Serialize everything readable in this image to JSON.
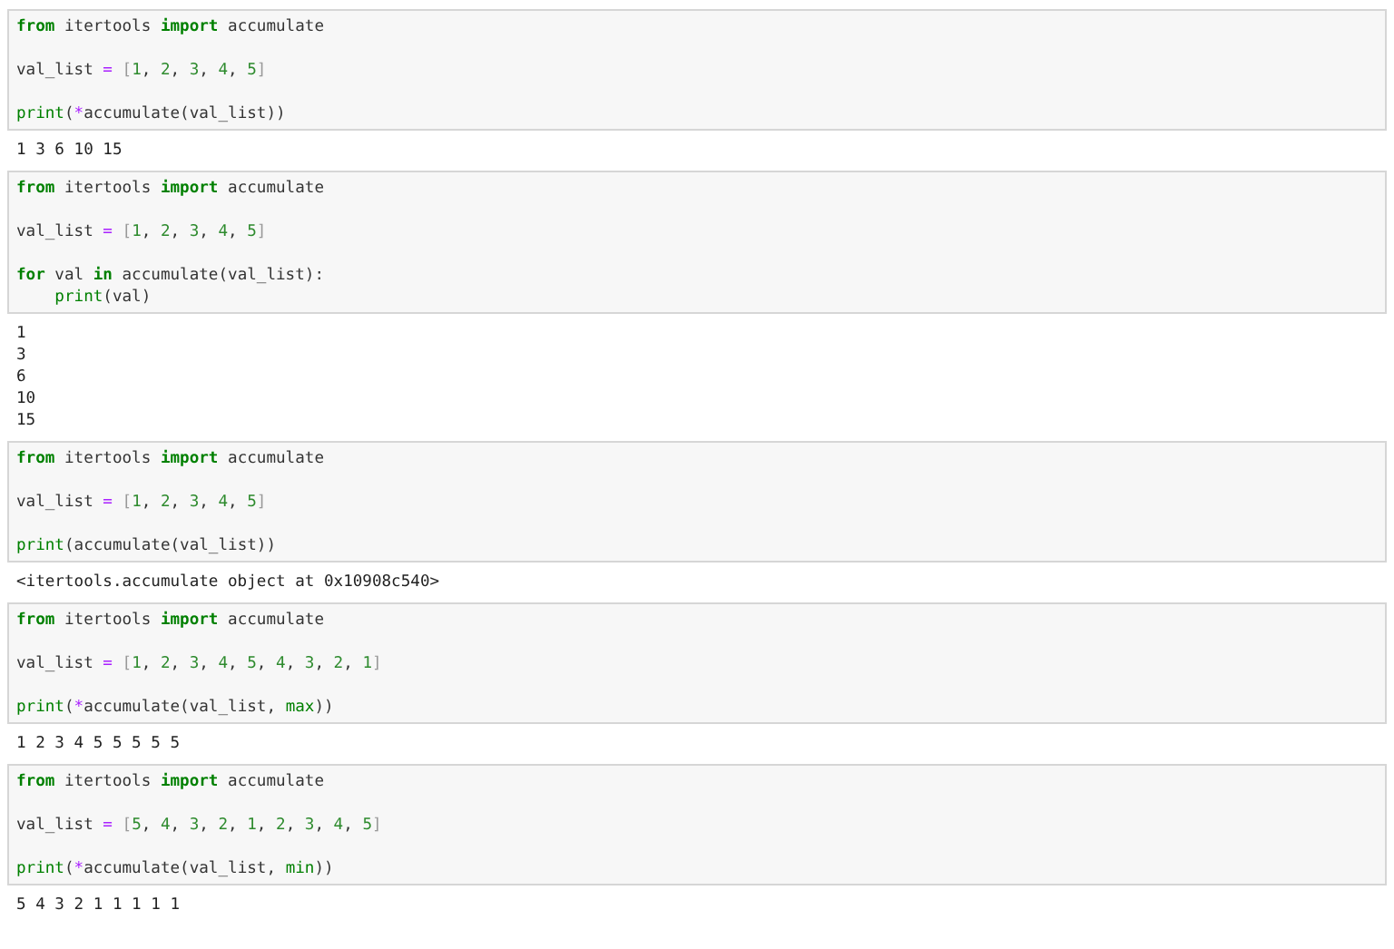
{
  "cells": [
    {
      "code": [
        [
          [
            {
              "text": "from",
              "kind": "kw"
            },
            {
              "text": " itertools ",
              "kind": "txt"
            },
            {
              "text": "import",
              "kind": "kw"
            },
            {
              "text": " accumulate",
              "kind": "txt"
            }
          ]
        ],
        [
          [
            {
              "text": "val_list ",
              "kind": "txt"
            },
            {
              "text": "=",
              "kind": "op"
            },
            {
              "text": " [",
              "kind": "br"
            },
            {
              "text": "1",
              "kind": "num"
            },
            {
              "text": ", ",
              "kind": "txt"
            },
            {
              "text": "2",
              "kind": "num"
            },
            {
              "text": ", ",
              "kind": "txt"
            },
            {
              "text": "3",
              "kind": "num"
            },
            {
              "text": ", ",
              "kind": "txt"
            },
            {
              "text": "4",
              "kind": "num"
            },
            {
              "text": ", ",
              "kind": "txt"
            },
            {
              "text": "5",
              "kind": "num"
            },
            {
              "text": "]",
              "kind": "br"
            }
          ]
        ],
        [
          [
            {
              "text": "print",
              "kind": "bi"
            },
            {
              "text": "(",
              "kind": "txt"
            },
            {
              "text": "*",
              "kind": "op"
            },
            {
              "text": "accumulate(val_list))",
              "kind": "txt"
            }
          ]
        ]
      ],
      "output": [
        "1 3 6 10 15"
      ]
    },
    {
      "code": [
        [
          [
            {
              "text": "from",
              "kind": "kw"
            },
            {
              "text": " itertools ",
              "kind": "txt"
            },
            {
              "text": "import",
              "kind": "kw"
            },
            {
              "text": " accumulate",
              "kind": "txt"
            }
          ]
        ],
        [
          [
            {
              "text": "val_list ",
              "kind": "txt"
            },
            {
              "text": "=",
              "kind": "op"
            },
            {
              "text": " [",
              "kind": "br"
            },
            {
              "text": "1",
              "kind": "num"
            },
            {
              "text": ", ",
              "kind": "txt"
            },
            {
              "text": "2",
              "kind": "num"
            },
            {
              "text": ", ",
              "kind": "txt"
            },
            {
              "text": "3",
              "kind": "num"
            },
            {
              "text": ", ",
              "kind": "txt"
            },
            {
              "text": "4",
              "kind": "num"
            },
            {
              "text": ", ",
              "kind": "txt"
            },
            {
              "text": "5",
              "kind": "num"
            },
            {
              "text": "]",
              "kind": "br"
            }
          ]
        ],
        [
          [
            {
              "text": "for",
              "kind": "kw"
            },
            {
              "text": " val ",
              "kind": "txt"
            },
            {
              "text": "in",
              "kind": "kw"
            },
            {
              "text": " accumulate(val_list):",
              "kind": "txt"
            }
          ],
          [
            {
              "text": "    print",
              "kind": "bi"
            },
            {
              "text": "(val)",
              "kind": "txt"
            }
          ]
        ]
      ],
      "output": [
        "1",
        "3",
        "6",
        "10",
        "15"
      ]
    },
    {
      "code": [
        [
          [
            {
              "text": "from",
              "kind": "kw"
            },
            {
              "text": " itertools ",
              "kind": "txt"
            },
            {
              "text": "import",
              "kind": "kw"
            },
            {
              "text": " accumulate",
              "kind": "txt"
            }
          ]
        ],
        [
          [
            {
              "text": "val_list ",
              "kind": "txt"
            },
            {
              "text": "=",
              "kind": "op"
            },
            {
              "text": " [",
              "kind": "br"
            },
            {
              "text": "1",
              "kind": "num"
            },
            {
              "text": ", ",
              "kind": "txt"
            },
            {
              "text": "2",
              "kind": "num"
            },
            {
              "text": ", ",
              "kind": "txt"
            },
            {
              "text": "3",
              "kind": "num"
            },
            {
              "text": ", ",
              "kind": "txt"
            },
            {
              "text": "4",
              "kind": "num"
            },
            {
              "text": ", ",
              "kind": "txt"
            },
            {
              "text": "5",
              "kind": "num"
            },
            {
              "text": "]",
              "kind": "br"
            }
          ]
        ],
        [
          [
            {
              "text": "print",
              "kind": "bi"
            },
            {
              "text": "(accumulate(val_list))",
              "kind": "txt"
            }
          ]
        ]
      ],
      "output": [
        "<itertools.accumulate object at 0x10908c540>"
      ]
    },
    {
      "code": [
        [
          [
            {
              "text": "from",
              "kind": "kw"
            },
            {
              "text": " itertools ",
              "kind": "txt"
            },
            {
              "text": "import",
              "kind": "kw"
            },
            {
              "text": " accumulate",
              "kind": "txt"
            }
          ]
        ],
        [
          [
            {
              "text": "val_list ",
              "kind": "txt"
            },
            {
              "text": "=",
              "kind": "op"
            },
            {
              "text": " [",
              "kind": "br"
            },
            {
              "text": "1",
              "kind": "num"
            },
            {
              "text": ", ",
              "kind": "txt"
            },
            {
              "text": "2",
              "kind": "num"
            },
            {
              "text": ", ",
              "kind": "txt"
            },
            {
              "text": "3",
              "kind": "num"
            },
            {
              "text": ", ",
              "kind": "txt"
            },
            {
              "text": "4",
              "kind": "num"
            },
            {
              "text": ", ",
              "kind": "txt"
            },
            {
              "text": "5",
              "kind": "num"
            },
            {
              "text": ", ",
              "kind": "txt"
            },
            {
              "text": "4",
              "kind": "num"
            },
            {
              "text": ", ",
              "kind": "txt"
            },
            {
              "text": "3",
              "kind": "num"
            },
            {
              "text": ", ",
              "kind": "txt"
            },
            {
              "text": "2",
              "kind": "num"
            },
            {
              "text": ", ",
              "kind": "txt"
            },
            {
              "text": "1",
              "kind": "num"
            },
            {
              "text": "]",
              "kind": "br"
            }
          ]
        ],
        [
          [
            {
              "text": "print",
              "kind": "bi"
            },
            {
              "text": "(",
              "kind": "txt"
            },
            {
              "text": "*",
              "kind": "op"
            },
            {
              "text": "accumulate(val_list, ",
              "kind": "txt"
            },
            {
              "text": "max",
              "kind": "bi"
            },
            {
              "text": "))",
              "kind": "txt"
            }
          ]
        ]
      ],
      "output": [
        "1 2 3 4 5 5 5 5 5"
      ]
    },
    {
      "code": [
        [
          [
            {
              "text": "from",
              "kind": "kw"
            },
            {
              "text": " itertools ",
              "kind": "txt"
            },
            {
              "text": "import",
              "kind": "kw"
            },
            {
              "text": " accumulate",
              "kind": "txt"
            }
          ]
        ],
        [
          [
            {
              "text": "val_list ",
              "kind": "txt"
            },
            {
              "text": "=",
              "kind": "op"
            },
            {
              "text": " [",
              "kind": "br"
            },
            {
              "text": "5",
              "kind": "num"
            },
            {
              "text": ", ",
              "kind": "txt"
            },
            {
              "text": "4",
              "kind": "num"
            },
            {
              "text": ", ",
              "kind": "txt"
            },
            {
              "text": "3",
              "kind": "num"
            },
            {
              "text": ", ",
              "kind": "txt"
            },
            {
              "text": "2",
              "kind": "num"
            },
            {
              "text": ", ",
              "kind": "txt"
            },
            {
              "text": "1",
              "kind": "num"
            },
            {
              "text": ", ",
              "kind": "txt"
            },
            {
              "text": "2",
              "kind": "num"
            },
            {
              "text": ", ",
              "kind": "txt"
            },
            {
              "text": "3",
              "kind": "num"
            },
            {
              "text": ", ",
              "kind": "txt"
            },
            {
              "text": "4",
              "kind": "num"
            },
            {
              "text": ", ",
              "kind": "txt"
            },
            {
              "text": "5",
              "kind": "num"
            },
            {
              "text": "]",
              "kind": "br"
            }
          ]
        ],
        [
          [
            {
              "text": "print",
              "kind": "bi"
            },
            {
              "text": "(",
              "kind": "txt"
            },
            {
              "text": "*",
              "kind": "op"
            },
            {
              "text": "accumulate(val_list, ",
              "kind": "txt"
            },
            {
              "text": "min",
              "kind": "bi"
            },
            {
              "text": "))",
              "kind": "txt"
            }
          ]
        ]
      ],
      "output": [
        "5 4 3 2 1 1 1 1 1"
      ]
    }
  ]
}
